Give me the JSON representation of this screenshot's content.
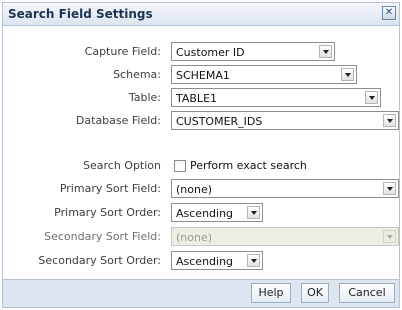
{
  "dialog": {
    "title": "Search Field Settings",
    "close_glyph": "✕"
  },
  "fields": {
    "capture_field": {
      "label": "Capture Field:",
      "value": "Customer ID"
    },
    "schema": {
      "label": "Schema:",
      "value": "SCHEMA1"
    },
    "table": {
      "label": "Table:",
      "value": "TABLE1"
    },
    "database_field": {
      "label": "Database Field:",
      "value": "CUSTOMER_IDS"
    },
    "search_option": {
      "label": "Search Option",
      "checkbox_label": "Perform exact search",
      "checked": false
    },
    "primary_sort_field": {
      "label": "Primary Sort Field:",
      "value": "(none)"
    },
    "primary_sort_order": {
      "label": "Primary Sort Order:",
      "value": "Ascending"
    },
    "secondary_sort_field": {
      "label": "Secondary Sort Field:",
      "value": "(none)",
      "disabled": true
    },
    "secondary_sort_order": {
      "label": "Secondary Sort Order:",
      "value": "Ascending"
    }
  },
  "buttons": {
    "help": "Help",
    "ok": "OK",
    "cancel": "Cancel"
  },
  "colors": {
    "title_text": "#1e3450",
    "titlebar": "#dbe4ef",
    "footer": "#dde6f0",
    "disabled_field": "#eceee4"
  }
}
